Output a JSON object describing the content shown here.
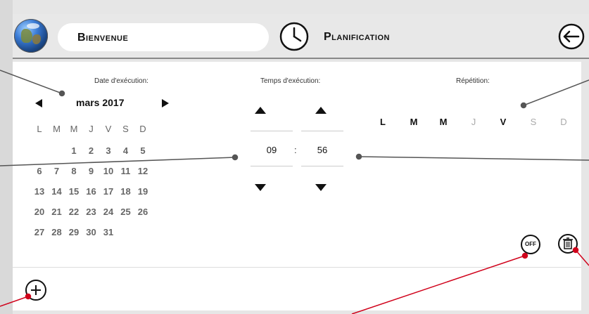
{
  "header": {
    "welcome": "Bienvenue",
    "planning_title": "Planification"
  },
  "date_section": {
    "label": "Date d'exécution:",
    "month": "mars 2017",
    "weekdays": [
      "L",
      "M",
      "M",
      "J",
      "V",
      "S",
      "D"
    ],
    "weeks": [
      [
        "",
        "",
        "1",
        "2",
        "3",
        "4",
        "5"
      ],
      [
        "6",
        "7",
        "8",
        "9",
        "10",
        "11",
        "12"
      ],
      [
        "13",
        "14",
        "15",
        "16",
        "17",
        "18",
        "19"
      ],
      [
        "20",
        "21",
        "22",
        "23",
        "24",
        "25",
        "26"
      ],
      [
        "27",
        "28",
        "29",
        "30",
        "31",
        "",
        ""
      ]
    ]
  },
  "time_section": {
    "label": "Temps d'exécution:",
    "hours": "09",
    "separator": ":",
    "minutes": "56"
  },
  "repetition": {
    "label": "Répétition:",
    "days": [
      {
        "letter": "L",
        "active": true
      },
      {
        "letter": "M",
        "active": true
      },
      {
        "letter": "M",
        "active": true
      },
      {
        "letter": "J",
        "active": false
      },
      {
        "letter": "V",
        "active": true
      },
      {
        "letter": "S",
        "active": false
      },
      {
        "letter": "D",
        "active": false
      }
    ]
  },
  "toggle": {
    "label": "OFF"
  },
  "colors": {
    "callout_gray": "#555555",
    "callout_red": "#d0021b",
    "inactive_day": "#aaaaaa"
  }
}
